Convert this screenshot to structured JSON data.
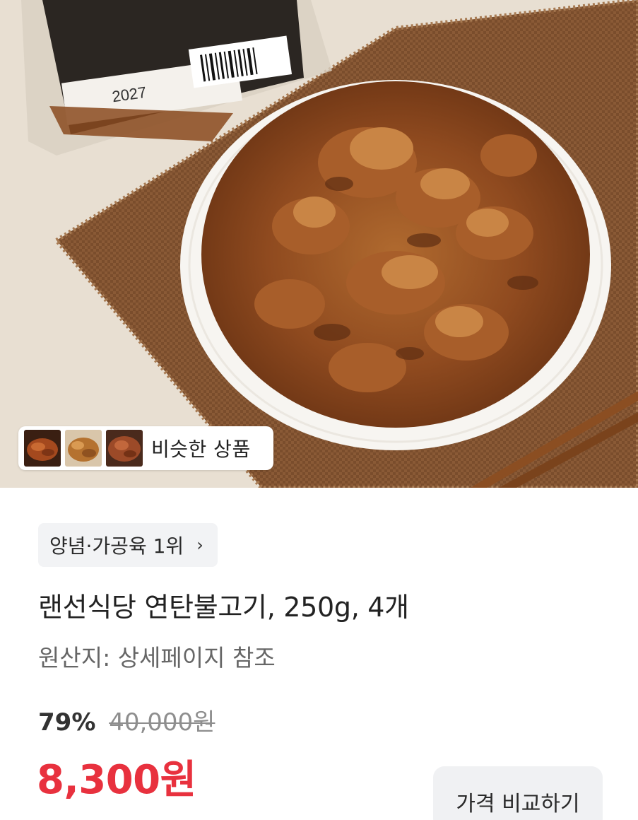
{
  "hero": {
    "package_label_text": "2027",
    "package_code_text": "2027",
    "similar_products": {
      "label": "비슷한 상품",
      "thumbnails": [
        {
          "icon": "bulgogi-thumbnail-1"
        },
        {
          "icon": "bulgogi-thumbnail-2"
        },
        {
          "icon": "bulgogi-thumbnail-3"
        }
      ]
    }
  },
  "product": {
    "rank_badge": "양념·가공육 1위",
    "rank_chevron": "›",
    "title": "랜선식당 연탄불고기, 250g, 4개",
    "origin": "원산지: 상세페이지 참조",
    "discount_rate": "79%",
    "original_price": "40,000원",
    "sale_price": "8,300원",
    "compare_button": "가격 비교하기"
  },
  "colors": {
    "sale_price": "#e8313e",
    "chip_background": "#f2f3f5",
    "muted_text": "#8e8e8e"
  }
}
